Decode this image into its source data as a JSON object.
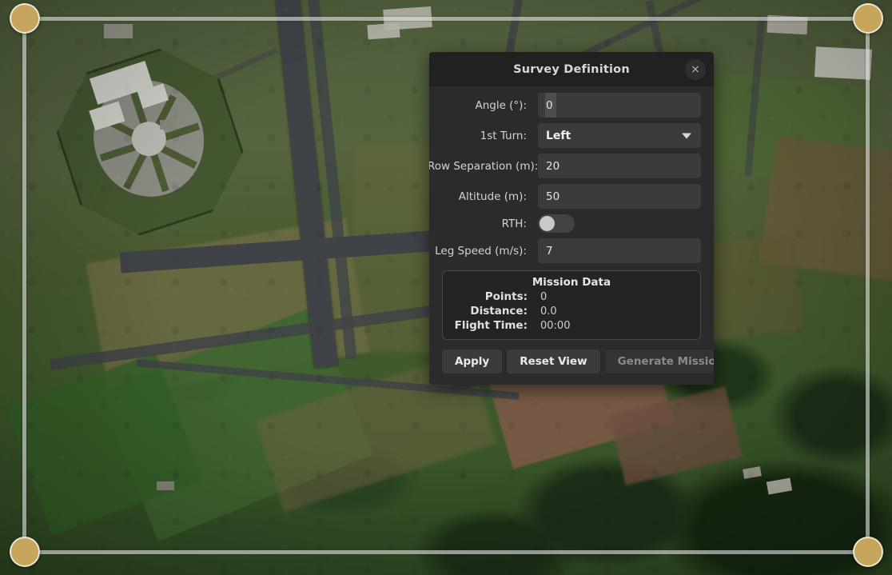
{
  "map": {
    "type": "satellite-imagery",
    "survey_polygon": {
      "handles": [
        {
          "name": "corner-handle-top-left",
          "color": "#c6a55c"
        },
        {
          "name": "corner-handle-top-right",
          "color": "#c6a55c"
        },
        {
          "name": "corner-handle-bottom-left",
          "color": "#c6a55c"
        },
        {
          "name": "corner-handle-bottom-right",
          "color": "#c6a55c"
        }
      ],
      "line_color": "#dedede"
    }
  },
  "dialog": {
    "title": "Survey Definition",
    "close_label": "×",
    "fields": [
      {
        "label": "Angle (°):",
        "value": "0",
        "type": "text",
        "name": "angle"
      },
      {
        "label": "1st Turn:",
        "value": "Left",
        "type": "select",
        "name": "first-turn"
      },
      {
        "label": "Row Separation (m):",
        "value": "20",
        "type": "text",
        "name": "row-separation"
      },
      {
        "label": "Altitude (m):",
        "value": "50",
        "type": "text",
        "name": "altitude"
      },
      {
        "label": "RTH:",
        "value": "off",
        "type": "toggle",
        "name": "rth"
      },
      {
        "label": "Leg Speed (m/s):",
        "value": "7",
        "type": "text",
        "name": "leg-speed"
      }
    ],
    "mission_data": {
      "title": "Mission Data",
      "rows": [
        {
          "key": "Points:",
          "value": "0"
        },
        {
          "key": "Distance:",
          "value": "0.0"
        },
        {
          "key": "Flight Time:",
          "value": "00:00"
        }
      ]
    },
    "buttons": [
      {
        "label": "Apply",
        "name": "apply",
        "disabled": false
      },
      {
        "label": "Reset View",
        "name": "reset-view",
        "disabled": false
      },
      {
        "label": "Generate Mission",
        "name": "generate-mission",
        "disabled": true
      }
    ]
  },
  "colors": {
    "dialog_bg": "#2b2b2b",
    "titlebar_bg": "#212121",
    "input_bg": "#3b3b3b",
    "accent_handle": "#c6a55c",
    "text": "#d6d6d6",
    "disabled_text": "#8a8a8a"
  }
}
